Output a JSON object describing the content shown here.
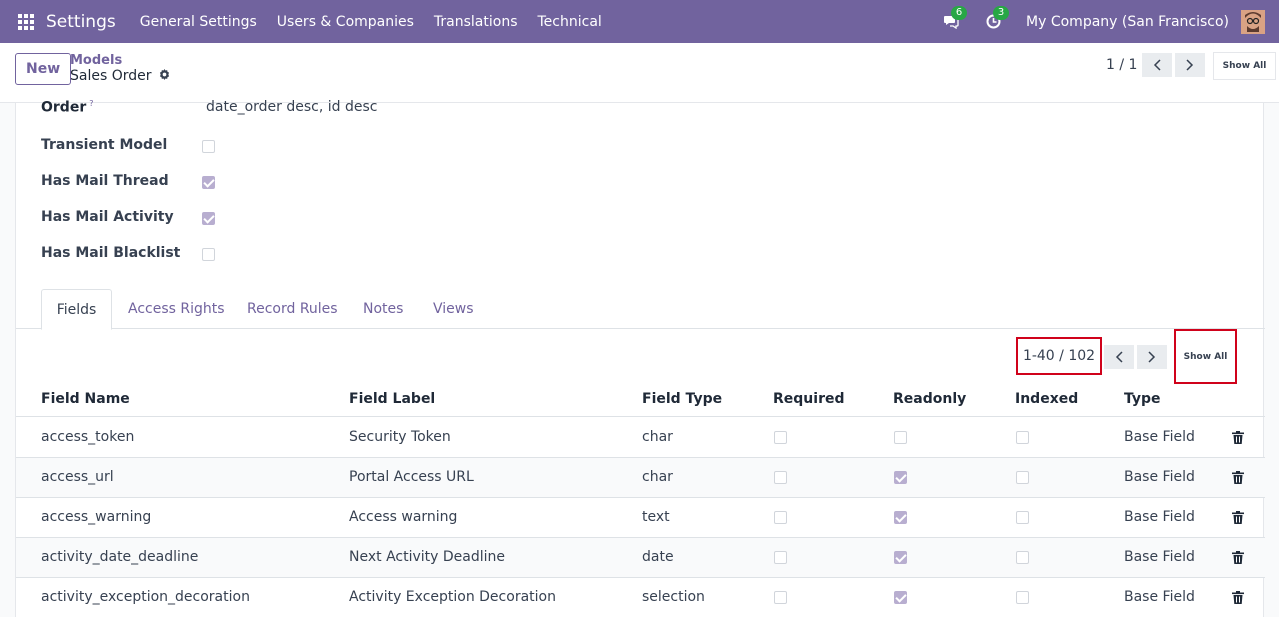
{
  "navbar": {
    "brand": "Settings",
    "menu": [
      "General Settings",
      "Users & Companies",
      "Translations",
      "Technical"
    ],
    "chat_badge": "6",
    "activity_badge": "3",
    "company": "My Company (San Francisco)"
  },
  "control": {
    "new_label": "New",
    "breadcrumb_parent": "Models",
    "breadcrumb_current": "Sales Order",
    "pager": "1 / 1",
    "show_all": "Show All"
  },
  "form": {
    "order_label": "Order",
    "order_help": "?",
    "order_value": "date_order desc, id desc",
    "fields": [
      {
        "label": "Transient Model",
        "checked": false
      },
      {
        "label": "Has Mail Thread",
        "checked": true
      },
      {
        "label": "Has Mail Activity",
        "checked": true
      },
      {
        "label": "Has Mail Blacklist",
        "checked": false
      }
    ]
  },
  "tabs": [
    "Fields",
    "Access Rights",
    "Record Rules",
    "Notes",
    "Views"
  ],
  "fields_tab": {
    "pager": "1-40 / 102",
    "show_all": "Show All",
    "columns": [
      "Field Name",
      "Field Label",
      "Field Type",
      "Required",
      "Readonly",
      "Indexed",
      "Type"
    ],
    "rows": [
      {
        "name": "access_token",
        "label": "Security Token",
        "type": "char",
        "required": false,
        "readonly": false,
        "indexed": false,
        "kind": "Base Field"
      },
      {
        "name": "access_url",
        "label": "Portal Access URL",
        "type": "char",
        "required": false,
        "readonly": true,
        "indexed": false,
        "kind": "Base Field"
      },
      {
        "name": "access_warning",
        "label": "Access warning",
        "type": "text",
        "required": false,
        "readonly": true,
        "indexed": false,
        "kind": "Base Field"
      },
      {
        "name": "activity_date_deadline",
        "label": "Next Activity Deadline",
        "type": "date",
        "required": false,
        "readonly": true,
        "indexed": false,
        "kind": "Base Field"
      },
      {
        "name": "activity_exception_decoration",
        "label": "Activity Exception Decoration",
        "type": "selection",
        "required": false,
        "readonly": true,
        "indexed": false,
        "kind": "Base Field"
      }
    ]
  }
}
